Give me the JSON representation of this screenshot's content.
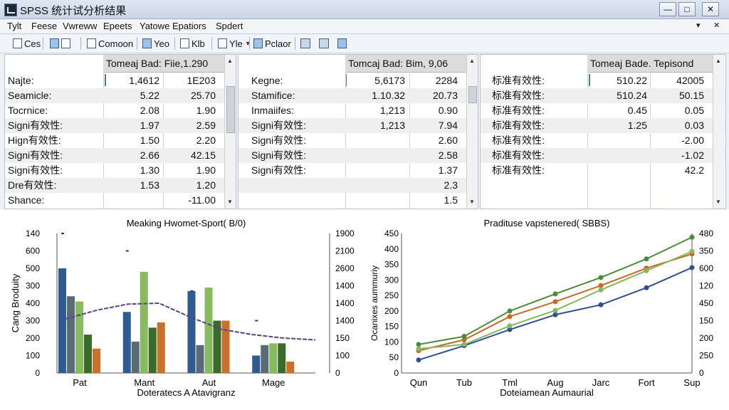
{
  "window": {
    "title": "SPSS 统计试分析结果"
  },
  "window_controls": {
    "minimize": "—",
    "maximize": "□",
    "close": "✕"
  },
  "menu": {
    "items": [
      "Tylt",
      "Feese",
      "Vwreww",
      "Epeets",
      "Yatowe",
      "Epatiors",
      "Spdert"
    ],
    "right_arrow": "▾",
    "right_close": "✕"
  },
  "toolbar": {
    "items": [
      "Ces",
      "Comoon",
      "Yeo",
      "Klb",
      "Yle",
      "Pclaor"
    ]
  },
  "panels": [
    {
      "header": "Tomeaj Bad: Fiie,1.290",
      "rows": [
        {
          "label": "Najte:",
          "v1": "1,4612",
          "v2": "1E203"
        },
        {
          "label": "Seamicle:",
          "v1": "5.22",
          "v2": "25.70"
        },
        {
          "label": "Tocrnice:",
          "v1": "2.08",
          "v2": "1.90"
        },
        {
          "label": "Signi有效性:",
          "v1": "1.97",
          "v2": "2.59"
        },
        {
          "label": "Hign有效性:",
          "v1": "1.50",
          "v2": "2.20"
        },
        {
          "label": "Signi有效性:",
          "v1": "2.66",
          "v2": "42.15"
        },
        {
          "label": "Signi有效性:",
          "v1": "1.30",
          "v2": "1.90"
        },
        {
          "label": "Dre有效性:",
          "v1": "1.53",
          "v2": "1.20"
        },
        {
          "label": "Shance:",
          "v1": "",
          "v2": "-11.00"
        }
      ]
    },
    {
      "header": "Tomcaj Bad: Bim, 9,06",
      "rows": [
        {
          "label": "Kegne:",
          "v1": "5,6173",
          "v2": "2284"
        },
        {
          "label": "Stamifice:",
          "v1": "1.10.32",
          "v2": "20.73"
        },
        {
          "label": "Inmaiifes:",
          "v1": "1,213",
          "v2": "0.90"
        },
        {
          "label": "Signi有效性:",
          "v1": "1,213",
          "v2": "7.94"
        },
        {
          "label": "Signi有效性:",
          "v1": "",
          "v2": "2.60"
        },
        {
          "label": "Signi有效性:",
          "v1": "",
          "v2": "2.58"
        },
        {
          "label": "Signi有效性:",
          "v1": "",
          "v2": "1.37"
        },
        {
          "label": "",
          "v1": "",
          "v2": "2.3"
        },
        {
          "label": "",
          "v1": "",
          "v2": "1.5"
        }
      ]
    },
    {
      "header": "Tomeaj Bade. Tepisond",
      "rows": [
        {
          "label": "标准有效性:",
          "v1": "510.22",
          "v2": "42005"
        },
        {
          "label": "标准有效性:",
          "v1": "510.24",
          "v2": "50.15"
        },
        {
          "label": "标准有效性:",
          "v1": "0.45",
          "v2": "0.05"
        },
        {
          "label": "标准有效性:",
          "v1": "1.25",
          "v2": "0.03"
        },
        {
          "label": "标准有效性:",
          "v1": "",
          "v2": "-2.00"
        },
        {
          "label": "标准有效性:",
          "v1": "",
          "v2": "-1.02"
        },
        {
          "label": "标准有效性:",
          "v1": "",
          "v2": "42.2"
        }
      ]
    }
  ],
  "chart_data": [
    {
      "type": "bar",
      "title": "Meaking Hwomet-Sport( B/0)",
      "xlabel": "Doteratecs A Atavigranz",
      "ylabel": "Cang Broduity",
      "categories": [
        "Pat",
        "Mant",
        "Aut",
        "Mage"
      ],
      "yticks": [
        "0",
        "100",
        "200",
        "300",
        "400",
        "300",
        "500",
        "600",
        "140"
      ],
      "ylim": [
        0,
        800
      ],
      "y2ticks": [
        "0",
        "100",
        "150",
        "1400",
        "1400",
        "1400",
        "2600",
        "2100",
        "1900"
      ],
      "bar_colors": [
        "#2f5b91",
        "#5a6b78",
        "#88bb60",
        "#3a6a2c",
        "#c8702c"
      ],
      "series": [
        {
          "values": [
            600,
            350,
            470,
            100
          ]
        },
        {
          "values": [
            440,
            180,
            160,
            160
          ]
        },
        {
          "values": [
            410,
            580,
            490,
            170
          ]
        },
        {
          "values": [
            220,
            260,
            300,
            170
          ]
        },
        {
          "values": [
            140,
            290,
            300,
            65
          ]
        }
      ],
      "line": {
        "color": "#5a3f8a",
        "values": [
          310,
          360,
          395,
          400,
          320,
          250,
          220,
          200,
          190
        ]
      },
      "markers": [
        {
          "category": 0,
          "value": 800
        },
        {
          "category": 1,
          "value": 700
        },
        {
          "category": 2,
          "value": 470
        },
        {
          "category": 3,
          "value": 300
        }
      ]
    },
    {
      "type": "line",
      "title": "Pradituse vapstenered( SBBS)",
      "xlabel": "Doteiamean Aumaurial",
      "ylabel": "Ocanixes aummuriy",
      "categories": [
        "Qun",
        "Tub",
        "Tml",
        "Aug",
        "Jarc",
        "Fort",
        "Sup"
      ],
      "yticks": [
        "0",
        "50",
        "100",
        "150",
        "200",
        "250",
        "300",
        "350",
        "400",
        "450"
      ],
      "ylim": [
        0,
        450
      ],
      "y2ticks": [
        "0",
        "250",
        "200",
        "150",
        "450",
        "120",
        "600",
        "350",
        "480"
      ],
      "series": [
        {
          "color": "#2f4f92",
          "values": [
            42,
            88,
            140,
            188,
            220,
            275,
            340
          ]
        },
        {
          "color": "#c46a26",
          "values": [
            72,
            107,
            182,
            230,
            282,
            338,
            384
          ]
        },
        {
          "color": "#4c8a3b",
          "values": [
            92,
            118,
            200,
            255,
            308,
            368,
            438
          ]
        },
        {
          "color": "#86b760",
          "values": [
            78,
            92,
            152,
            202,
            268,
            330,
            392
          ]
        }
      ]
    }
  ]
}
